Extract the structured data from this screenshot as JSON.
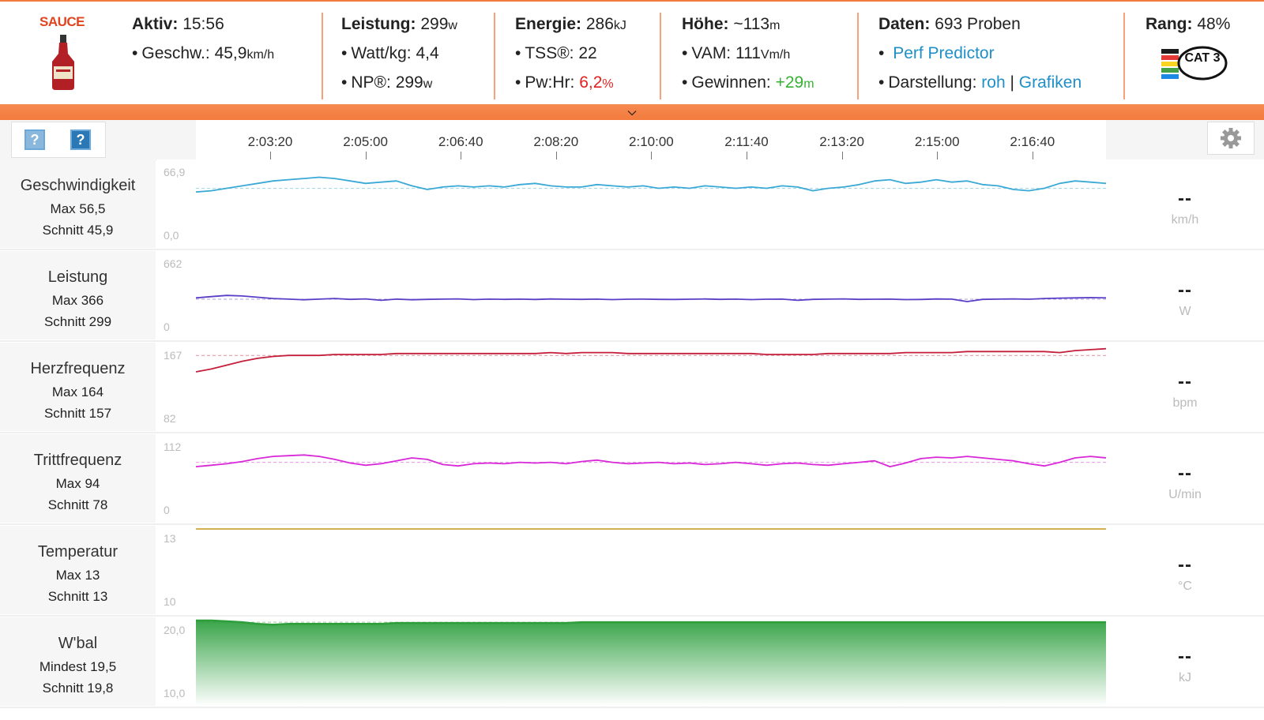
{
  "header": {
    "logo_text": "SAUCE",
    "aktiv": {
      "label": "Aktiv:",
      "value": "15:56"
    },
    "geschw": {
      "label": "Geschw.:",
      "value": "45,9",
      "unit": "km/h"
    },
    "leistung": {
      "label": "Leistung:",
      "value": "299",
      "unit": "w"
    },
    "wattkg": {
      "label": "Watt/kg:",
      "value": "4,4"
    },
    "np": {
      "label": "NP®:",
      "value": "299",
      "unit": "w"
    },
    "energie": {
      "label": "Energie:",
      "value": "286",
      "unit": "kJ"
    },
    "tss": {
      "label": "TSS®:",
      "value": "22"
    },
    "pwhr": {
      "label": "Pw:Hr:",
      "value": "6,2",
      "unit": "%"
    },
    "hoehe": {
      "label": "Höhe:",
      "value": "~113",
      "unit": "m"
    },
    "vam": {
      "label": "VAM:",
      "value": "111",
      "unit": "Vm/h"
    },
    "gewinnen": {
      "label": "Gewinnen:",
      "value": "+29",
      "unit": "m"
    },
    "daten": {
      "label": "Daten:",
      "value": "693 Proben"
    },
    "perf_predictor": "Perf Predictor",
    "darstellung": {
      "label": "Darstellung:",
      "roh": "roh",
      "sep": "|",
      "grafiken": "Grafiken"
    },
    "rang": {
      "label": "Rang:",
      "value": "48%"
    },
    "cat_badge": "CAT 3"
  },
  "toolbar": {
    "help1": "?",
    "help2": "?",
    "gear_icon": "gear-icon",
    "time_ticks": [
      "2:03:20",
      "2:05:00",
      "2:06:40",
      "2:08:20",
      "2:10:00",
      "2:11:40",
      "2:13:20",
      "2:15:00",
      "2:16:40"
    ]
  },
  "rows": [
    {
      "name": "Geschwindigkeit",
      "max": "Max 56,5",
      "avg": "Schnitt 45,9",
      "ymax": "66,9",
      "ymin": "0,0",
      "unit": "km/h",
      "live": "--",
      "color": "#3aa9d6"
    },
    {
      "name": "Leistung",
      "max": "Max 366",
      "avg": "Schnitt 299",
      "ymax": "662",
      "ymin": "0",
      "unit": "W",
      "live": "--",
      "color": "#5b3ec7"
    },
    {
      "name": "Herzfrequenz",
      "max": "Max 164",
      "avg": "Schnitt 157",
      "ymax": "167",
      "ymin": "82",
      "unit": "bpm",
      "live": "--",
      "color": "#c41e3a"
    },
    {
      "name": "Trittfrequenz",
      "max": "Max 94",
      "avg": "Schnitt 78",
      "ymax": "112",
      "ymin": "0",
      "unit": "U/min",
      "live": "--",
      "color": "#d828d8"
    },
    {
      "name": "Temperatur",
      "max": "Max 13",
      "avg": "Schnitt 13",
      "ymax": "13",
      "ymin": "10",
      "unit": "°C",
      "live": "--",
      "color": "#c9a43a"
    },
    {
      "name": "W'bal",
      "max": "Mindest 19,5",
      "avg": "Schnitt 19,8",
      "ymax": "20,0",
      "ymin": "10,0",
      "unit": "kJ",
      "live": "--",
      "color": "#2e9e3a"
    }
  ],
  "chart_data": {
    "type": "line",
    "x_range": [
      "2:02:00",
      "2:17:56"
    ],
    "x_ticks": [
      "2:03:20",
      "2:05:00",
      "2:06:40",
      "2:08:20",
      "2:10:00",
      "2:11:40",
      "2:13:20",
      "2:15:00",
      "2:16:40"
    ],
    "series": [
      {
        "name": "Geschwindigkeit",
        "ylim": [
          0.0,
          66.9
        ],
        "avg": 45.9,
        "values": [
          43,
          44,
          46,
          48,
          50,
          52,
          53,
          54,
          55,
          54,
          52,
          50,
          51,
          52,
          48,
          45,
          47,
          48,
          47,
          48,
          47,
          49,
          50,
          48,
          47,
          47,
          49,
          48,
          47,
          48,
          46,
          47,
          46,
          48,
          47,
          46,
          47,
          46,
          48,
          47,
          44,
          46,
          47,
          49,
          52,
          53,
          50,
          51,
          53,
          51,
          52,
          49,
          48,
          45,
          44,
          46,
          50,
          52,
          51,
          50
        ]
      },
      {
        "name": "Leistung",
        "ylim": [
          0,
          662
        ],
        "avg": 299,
        "values": [
          310,
          320,
          330,
          325,
          315,
          305,
          300,
          295,
          300,
          305,
          298,
          302,
          290,
          300,
          295,
          298,
          300,
          302,
          296,
          300,
          298,
          300,
          297,
          301,
          299,
          298,
          300,
          296,
          299,
          300,
          298,
          297,
          299,
          301,
          298,
          300,
          296,
          299,
          300,
          290,
          298,
          300,
          302,
          298,
          299,
          300,
          296,
          297,
          301,
          300,
          280,
          298,
          300,
          302,
          299,
          305,
          308,
          310,
          312,
          310
        ]
      },
      {
        "name": "Herzfrequenz",
        "ylim": [
          82,
          167
        ],
        "avg": 157,
        "values": [
          140,
          143,
          147,
          151,
          154,
          156,
          157,
          157,
          157,
          158,
          158,
          158,
          158,
          159,
          159,
          159,
          159,
          159,
          159,
          159,
          159,
          159,
          159,
          160,
          159,
          160,
          160,
          160,
          159,
          159,
          159,
          159,
          159,
          159,
          159,
          159,
          159,
          158,
          158,
          158,
          158,
          159,
          159,
          159,
          159,
          159,
          160,
          160,
          160,
          160,
          161,
          161,
          161,
          161,
          161,
          161,
          160,
          162,
          163,
          164
        ]
      },
      {
        "name": "Trittfrequenz",
        "ylim": [
          0,
          112
        ],
        "avg": 78,
        "values": [
          72,
          74,
          76,
          79,
          83,
          86,
          87,
          88,
          86,
          82,
          77,
          74,
          76,
          80,
          84,
          82,
          75,
          73,
          76,
          77,
          76,
          78,
          77,
          78,
          76,
          79,
          81,
          78,
          76,
          77,
          78,
          76,
          77,
          75,
          76,
          78,
          76,
          74,
          76,
          77,
          75,
          74,
          76,
          78,
          80,
          72,
          77,
          83,
          85,
          84,
          86,
          84,
          82,
          80,
          76,
          73,
          78,
          84,
          86,
          84
        ]
      },
      {
        "name": "Temperatur",
        "ylim": [
          10,
          13
        ],
        "avg": 13,
        "values": [
          13,
          13,
          13,
          13,
          13,
          13,
          13,
          13,
          13,
          13,
          13,
          13,
          13,
          13,
          13,
          13,
          13,
          13,
          13,
          13,
          13,
          13,
          13,
          13,
          13,
          13,
          13,
          13,
          13,
          13,
          13,
          13,
          13,
          13,
          13,
          13,
          13,
          13,
          13,
          13,
          13,
          13,
          13,
          13,
          13,
          13,
          13,
          13,
          13,
          13,
          13,
          13,
          13,
          13,
          13,
          13,
          13,
          13,
          13,
          13
        ]
      },
      {
        "name": "W'bal",
        "ylim": [
          10.0,
          20.0
        ],
        "avg": 19.8,
        "values": [
          20.0,
          20.0,
          19.9,
          19.8,
          19.6,
          19.5,
          19.6,
          19.6,
          19.6,
          19.6,
          19.6,
          19.6,
          19.6,
          19.7,
          19.7,
          19.7,
          19.7,
          19.7,
          19.7,
          19.7,
          19.7,
          19.7,
          19.7,
          19.7,
          19.7,
          19.8,
          19.8,
          19.8,
          19.8,
          19.8,
          19.8,
          19.8,
          19.8,
          19.8,
          19.8,
          19.8,
          19.8,
          19.8,
          19.8,
          19.8,
          19.8,
          19.8,
          19.8,
          19.8,
          19.8,
          19.8,
          19.8,
          19.8,
          19.8,
          19.8,
          19.8,
          19.8,
          19.8,
          19.8,
          19.8,
          19.8,
          19.8,
          19.8,
          19.8,
          19.8
        ]
      }
    ]
  }
}
